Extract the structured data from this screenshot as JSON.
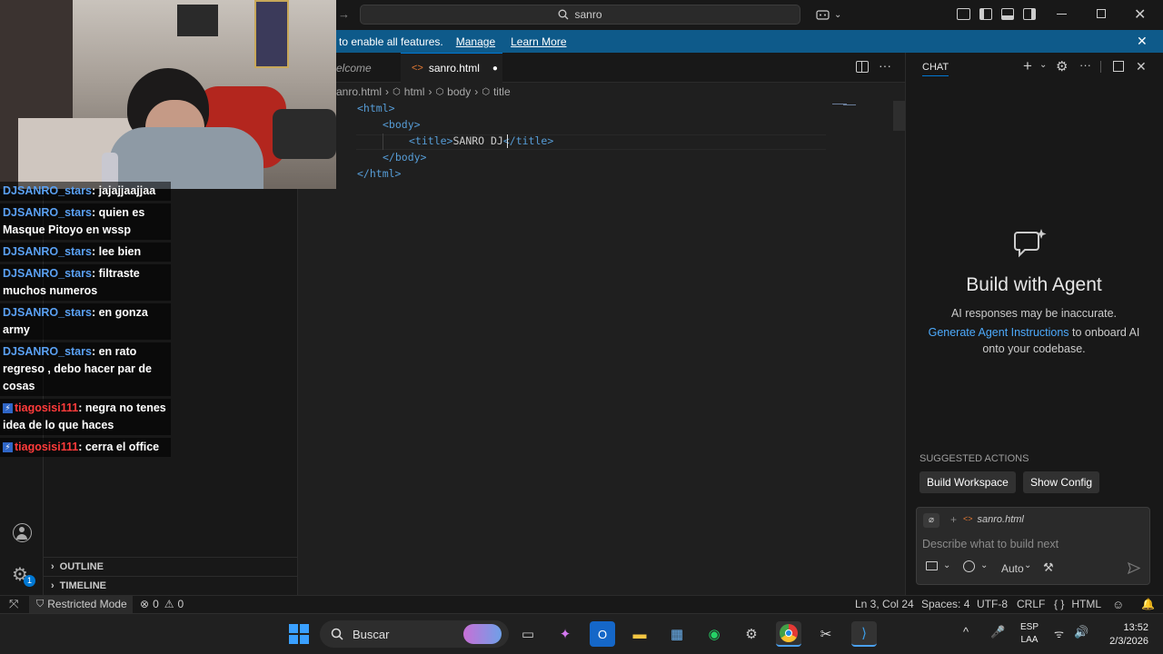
{
  "window": {
    "search_text": "sanro"
  },
  "notification": {
    "text": "to enable all features.",
    "link_manage": "Manage",
    "link_learn": "Learn More"
  },
  "tabs": [
    {
      "label": "elcome"
    },
    {
      "label": "sanro.html"
    }
  ],
  "breadcrumb": {
    "file": "anro.html",
    "items": [
      "html",
      "body",
      "title"
    ]
  },
  "code": {
    "line1_open": "<html>",
    "line2_open": "<body>",
    "line3_tag_open": "<title>",
    "line3_text": "SANRO DJ",
    "line3_tag_close": "</title>",
    "line4_close": "</body>",
    "line5_close": "</html>"
  },
  "sidebar": {
    "outline": "OUTLINE",
    "timeline": "TIMELINE",
    "settings_badge": "1"
  },
  "chat": {
    "header": "CHAT",
    "title": "Build with Agent",
    "subtitle": "AI responses may be inaccurate.",
    "link": "Generate Agent Instructions",
    "desc_rest": " to onboard AI",
    "desc_line2": "onto your codebase.",
    "suggested": "SUGGESTED ACTIONS",
    "btn_build": "Build Workspace",
    "btn_config": "Show Config",
    "attached_file": "sanro.html",
    "placeholder": "Describe what to build next",
    "mode": "Auto"
  },
  "status": {
    "restricted": "Restricted Mode",
    "errors": "0",
    "warnings": "0",
    "position": "Ln 3, Col 24",
    "spaces": "Spaces: 4",
    "encoding": "UTF-8",
    "eol": "CRLF",
    "braces": "{ }",
    "language": "HTML"
  },
  "taskbar": {
    "search_label": "Buscar",
    "lang_line1": "ESP",
    "lang_line2": "LAA",
    "time": "13:52",
    "date": "2/3/2026"
  },
  "stream_chat": [
    {
      "user": "DJSANRO_stars",
      "msg": ": jajajjaajjaa",
      "color": "blue",
      "badge": false
    },
    {
      "user": "DJSANRO_stars",
      "msg": ": quien es Masque Pitoyo en wssp",
      "color": "blue",
      "badge": false
    },
    {
      "user": "DJSANRO_stars",
      "msg": ": lee bien",
      "color": "blue",
      "badge": false
    },
    {
      "user": "DJSANRO_stars",
      "msg": ": filtraste muchos numeros",
      "color": "blue",
      "badge": false
    },
    {
      "user": "DJSANRO_stars",
      "msg": ": en gonza army",
      "color": "blue",
      "badge": false
    },
    {
      "user": "DJSANRO_stars",
      "msg": ": en rato regreso , debo hacer par de cosas",
      "color": "blue",
      "badge": false
    },
    {
      "user": "tiagosisi111",
      "msg": ": negra no tenes idea de lo que haces",
      "color": "red",
      "badge": true
    },
    {
      "user": "tiagosisi111",
      "msg": ": cerra el office",
      "color": "red",
      "badge": true
    }
  ]
}
